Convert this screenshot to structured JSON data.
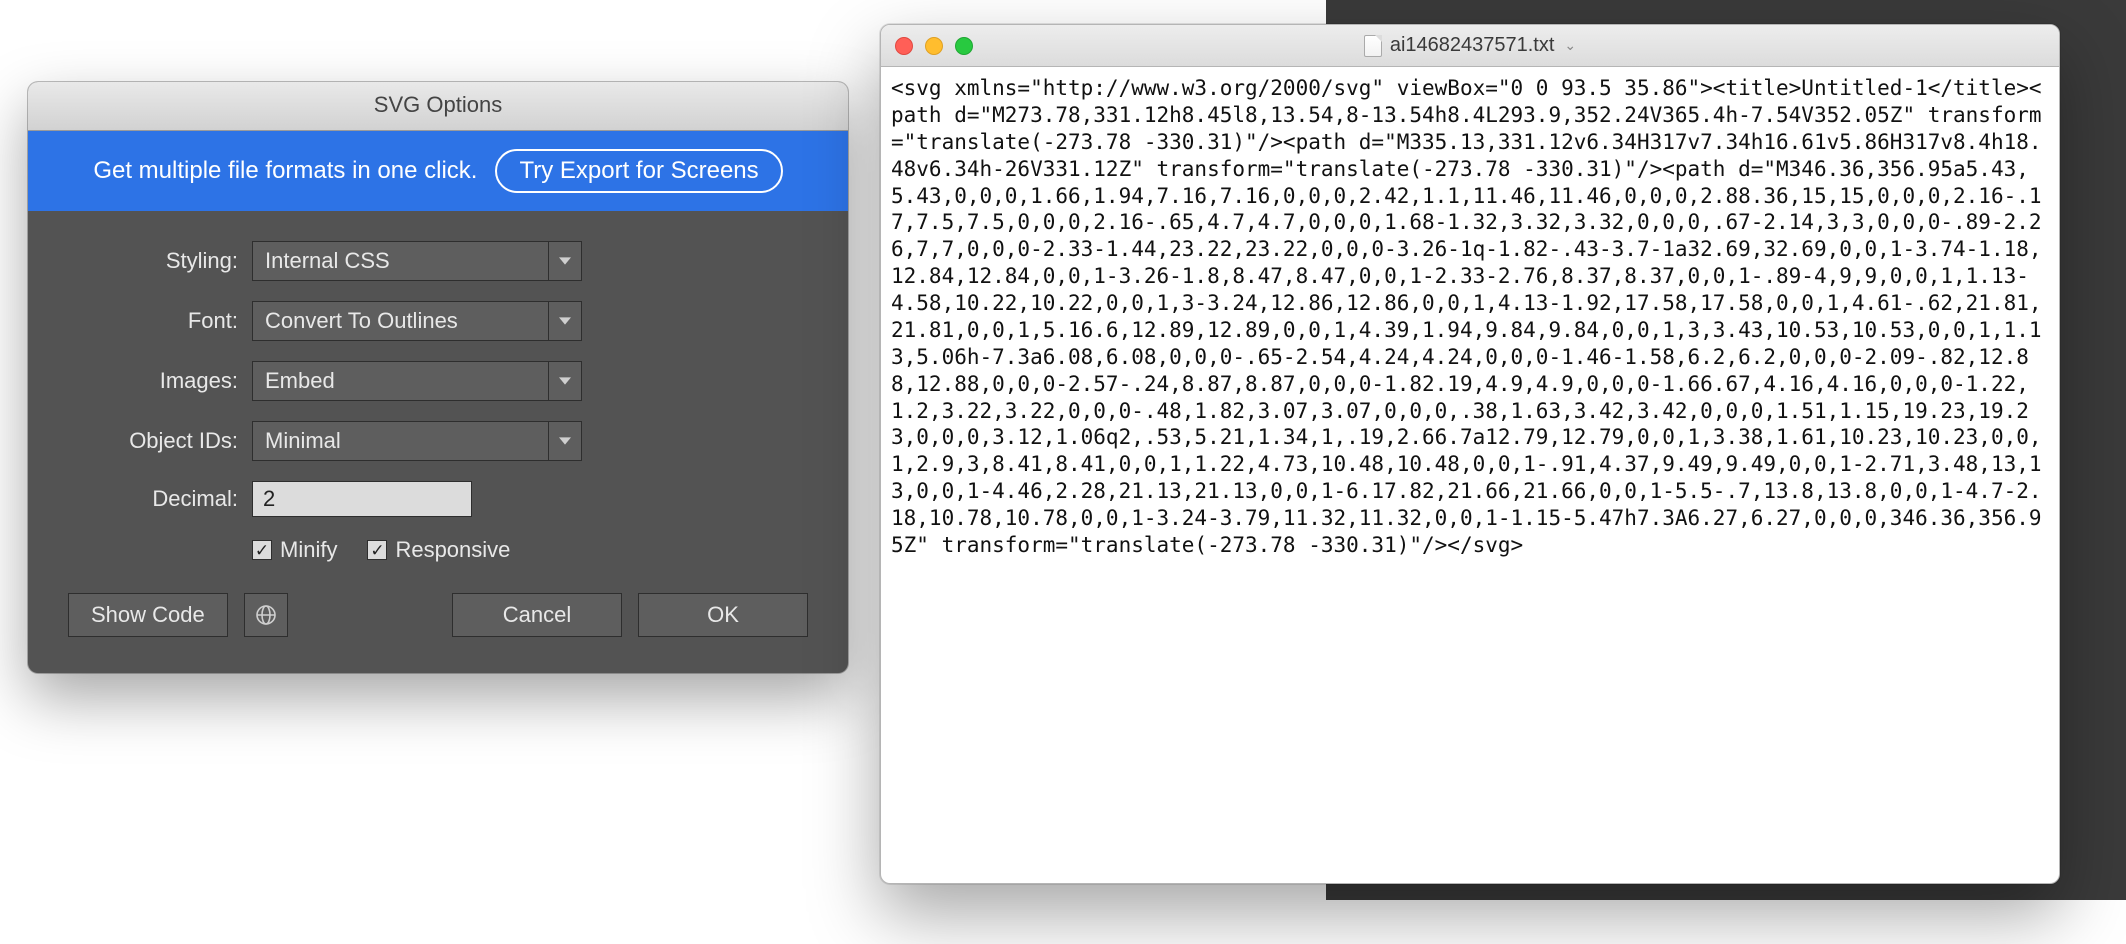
{
  "dialog": {
    "title": "SVG Options",
    "promo_text": "Get multiple file formats in one click.",
    "promo_button": "Try Export for Screens",
    "labels": {
      "styling": "Styling:",
      "font": "Font:",
      "images": "Images:",
      "object_ids": "Object IDs:",
      "decimal": "Decimal:"
    },
    "values": {
      "styling": "Internal CSS",
      "font": "Convert To Outlines",
      "images": "Embed",
      "object_ids": "Minimal",
      "decimal": "2"
    },
    "checkboxes": {
      "minify": {
        "label": "Minify",
        "checked": true
      },
      "responsive": {
        "label": "Responsive",
        "checked": true
      }
    },
    "buttons": {
      "show_code": "Show Code",
      "cancel": "Cancel",
      "ok": "OK"
    }
  },
  "text_window": {
    "filename": "ai14682437571.txt",
    "content": "<svg xmlns=\"http://www.w3.org/2000/svg\" viewBox=\"0 0 93.5 35.86\"><title>Untitled-1</title><path d=\"M273.78,331.12h8.45l8,13.54,8-13.54h8.4L293.9,352.24V365.4h-7.54V352.05Z\" transform=\"translate(-273.78 -330.31)\"/><path d=\"M335.13,331.12v6.34H317v7.34h16.61v5.86H317v8.4h18.48v6.34h-26V331.12Z\" transform=\"translate(-273.78 -330.31)\"/><path d=\"M346.36,356.95a5.43,5.43,0,0,0,1.66,1.94,7.16,7.16,0,0,0,2.42,1.1,11.46,11.46,0,0,0,2.88.36,15,15,0,0,0,2.16-.17,7.5,7.5,0,0,0,2.16-.65,4.7,4.7,0,0,0,1.68-1.32,3.32,3.32,0,0,0,.67-2.14,3,3,0,0,0-.89-2.26,7,7,0,0,0-2.33-1.44,23.22,23.22,0,0,0-3.26-1q-1.82-.43-3.7-1a32.69,32.69,0,0,1-3.74-1.18,12.84,12.84,0,0,1-3.26-1.8,8.47,8.47,0,0,1-2.33-2.76,8.37,8.37,0,0,1-.89-4,9,9,0,0,1,1.13-4.58,10.22,10.22,0,0,1,3-3.24,12.86,12.86,0,0,1,4.13-1.92,17.58,17.58,0,0,1,4.61-.62,21.81,21.81,0,0,1,5.16.6,12.89,12.89,0,0,1,4.39,1.94,9.84,9.84,0,0,1,3,3.43,10.53,10.53,0,0,1,1.13,5.06h-7.3a6.08,6.08,0,0,0-.65-2.54,4.24,4.24,0,0,0-1.46-1.58,6.2,6.2,0,0,0-2.09-.82,12.88,12.88,0,0,0-2.57-.24,8.87,8.87,0,0,0-1.82.19,4.9,4.9,0,0,0-1.66.67,4.16,4.16,0,0,0-1.22,1.2,3.22,3.22,0,0,0-.48,1.82,3.07,3.07,0,0,0,.38,1.63,3.42,3.42,0,0,0,1.51,1.15,19.23,19.23,0,0,0,3.12,1.06q2,.53,5.21,1.34,1,.19,2.66.7a12.79,12.79,0,0,1,3.38,1.61,10.23,10.23,0,0,1,2.9,3,8.41,8.41,0,0,1,1.22,4.73,10.48,10.48,0,0,1-.91,4.37,9.49,9.49,0,0,1-2.71,3.48,13,13,0,0,1-4.46,2.28,21.13,21.13,0,0,1-6.17.82,21.66,21.66,0,0,1-5.5-.7,13.8,13.8,0,0,1-4.7-2.18,10.78,10.78,0,0,1-3.24-3.79,11.32,11.32,0,0,1-1.15-5.47h7.3A6.27,6.27,0,0,0,346.36,356.95Z\" transform=\"translate(-273.78 -330.31)\"/></svg>"
  }
}
